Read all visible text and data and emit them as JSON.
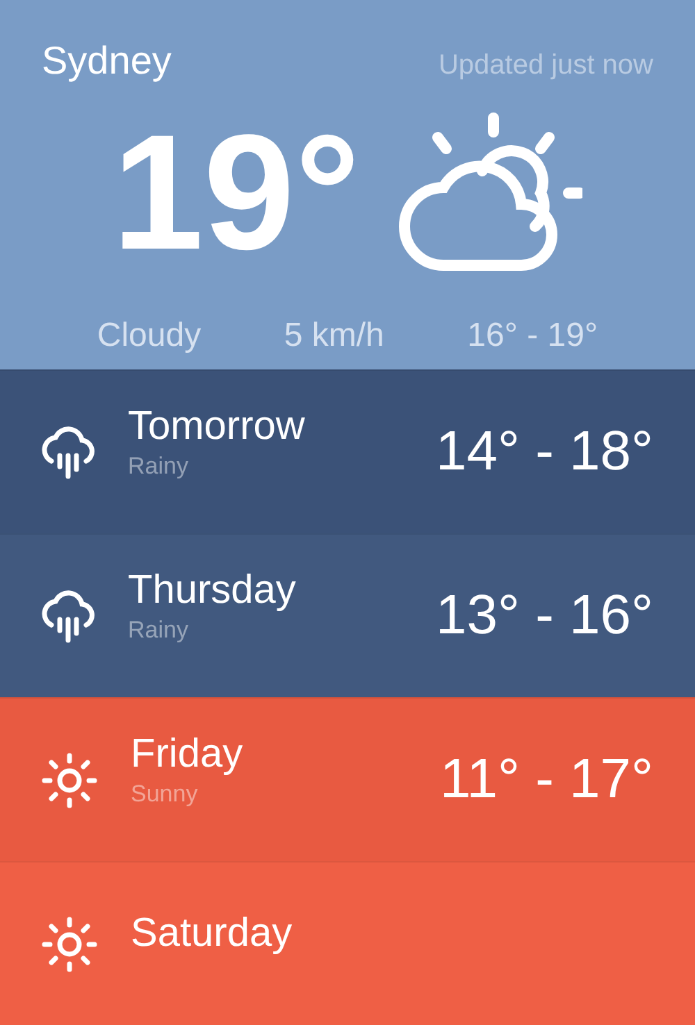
{
  "current": {
    "city": "Sydney",
    "updated": "Updated just now",
    "temperature": "19°",
    "condition": "Cloudy",
    "wind": "5 km/h",
    "range": "16° - 19°"
  },
  "forecast": [
    {
      "day": "Tomorrow",
      "condition": "Rainy",
      "range": "14° - 18°",
      "kind": "rainy",
      "color": "#3b5278"
    },
    {
      "day": "Thursday",
      "condition": "Rainy",
      "range": "13° - 16°",
      "kind": "rainy",
      "color": "#41597f"
    },
    {
      "day": "Friday",
      "condition": "Sunny",
      "range": "11° - 17°",
      "kind": "sunny",
      "color": "#e85a41"
    },
    {
      "day": "Saturday",
      "kind": "sunny",
      "color": "#ef5f45"
    }
  ]
}
